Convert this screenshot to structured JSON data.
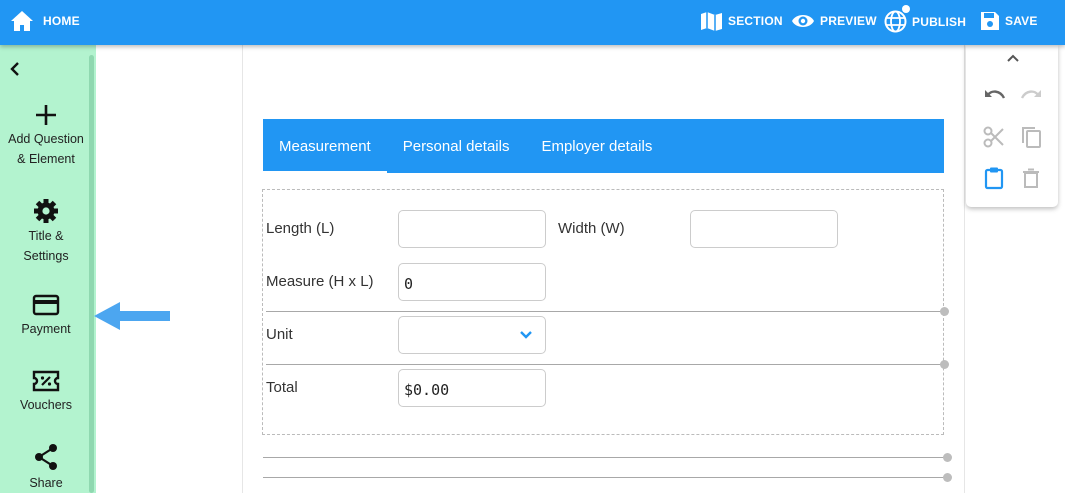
{
  "topbar": {
    "home_label": "HOME",
    "section_label": "SECTION",
    "preview_label": "PREVIEW",
    "publish_label": "PUBLISH",
    "save_label": "SAVE"
  },
  "sidebar": {
    "items": [
      {
        "line1": "Add Question",
        "line2": "& Element",
        "icon": "plus-icon"
      },
      {
        "line1": "Title &",
        "line2": "Settings",
        "icon": "gear-icon"
      },
      {
        "line1": "Payment",
        "line2": "",
        "icon": "credit-card-icon"
      },
      {
        "line1": "Vouchers",
        "line2": "",
        "icon": "voucher-icon"
      },
      {
        "line1": "Share",
        "line2": "",
        "icon": "share-icon"
      }
    ]
  },
  "tabs": [
    {
      "label": "Measurement",
      "active": true
    },
    {
      "label": "Personal details",
      "active": false
    },
    {
      "label": "Employer details",
      "active": false
    }
  ],
  "form": {
    "length_label": "Length (L)",
    "length_value": "",
    "width_label": "Width (W)",
    "width_value": "",
    "measure_label": "Measure (H x L)",
    "measure_value": "0",
    "unit_label": "Unit",
    "unit_value": "",
    "total_label": "Total",
    "total_value": "$0.00"
  },
  "colors": {
    "primary": "#2196f3",
    "sidebar_bg": "#b3f3cf",
    "arrow": "#4ca6f0"
  }
}
